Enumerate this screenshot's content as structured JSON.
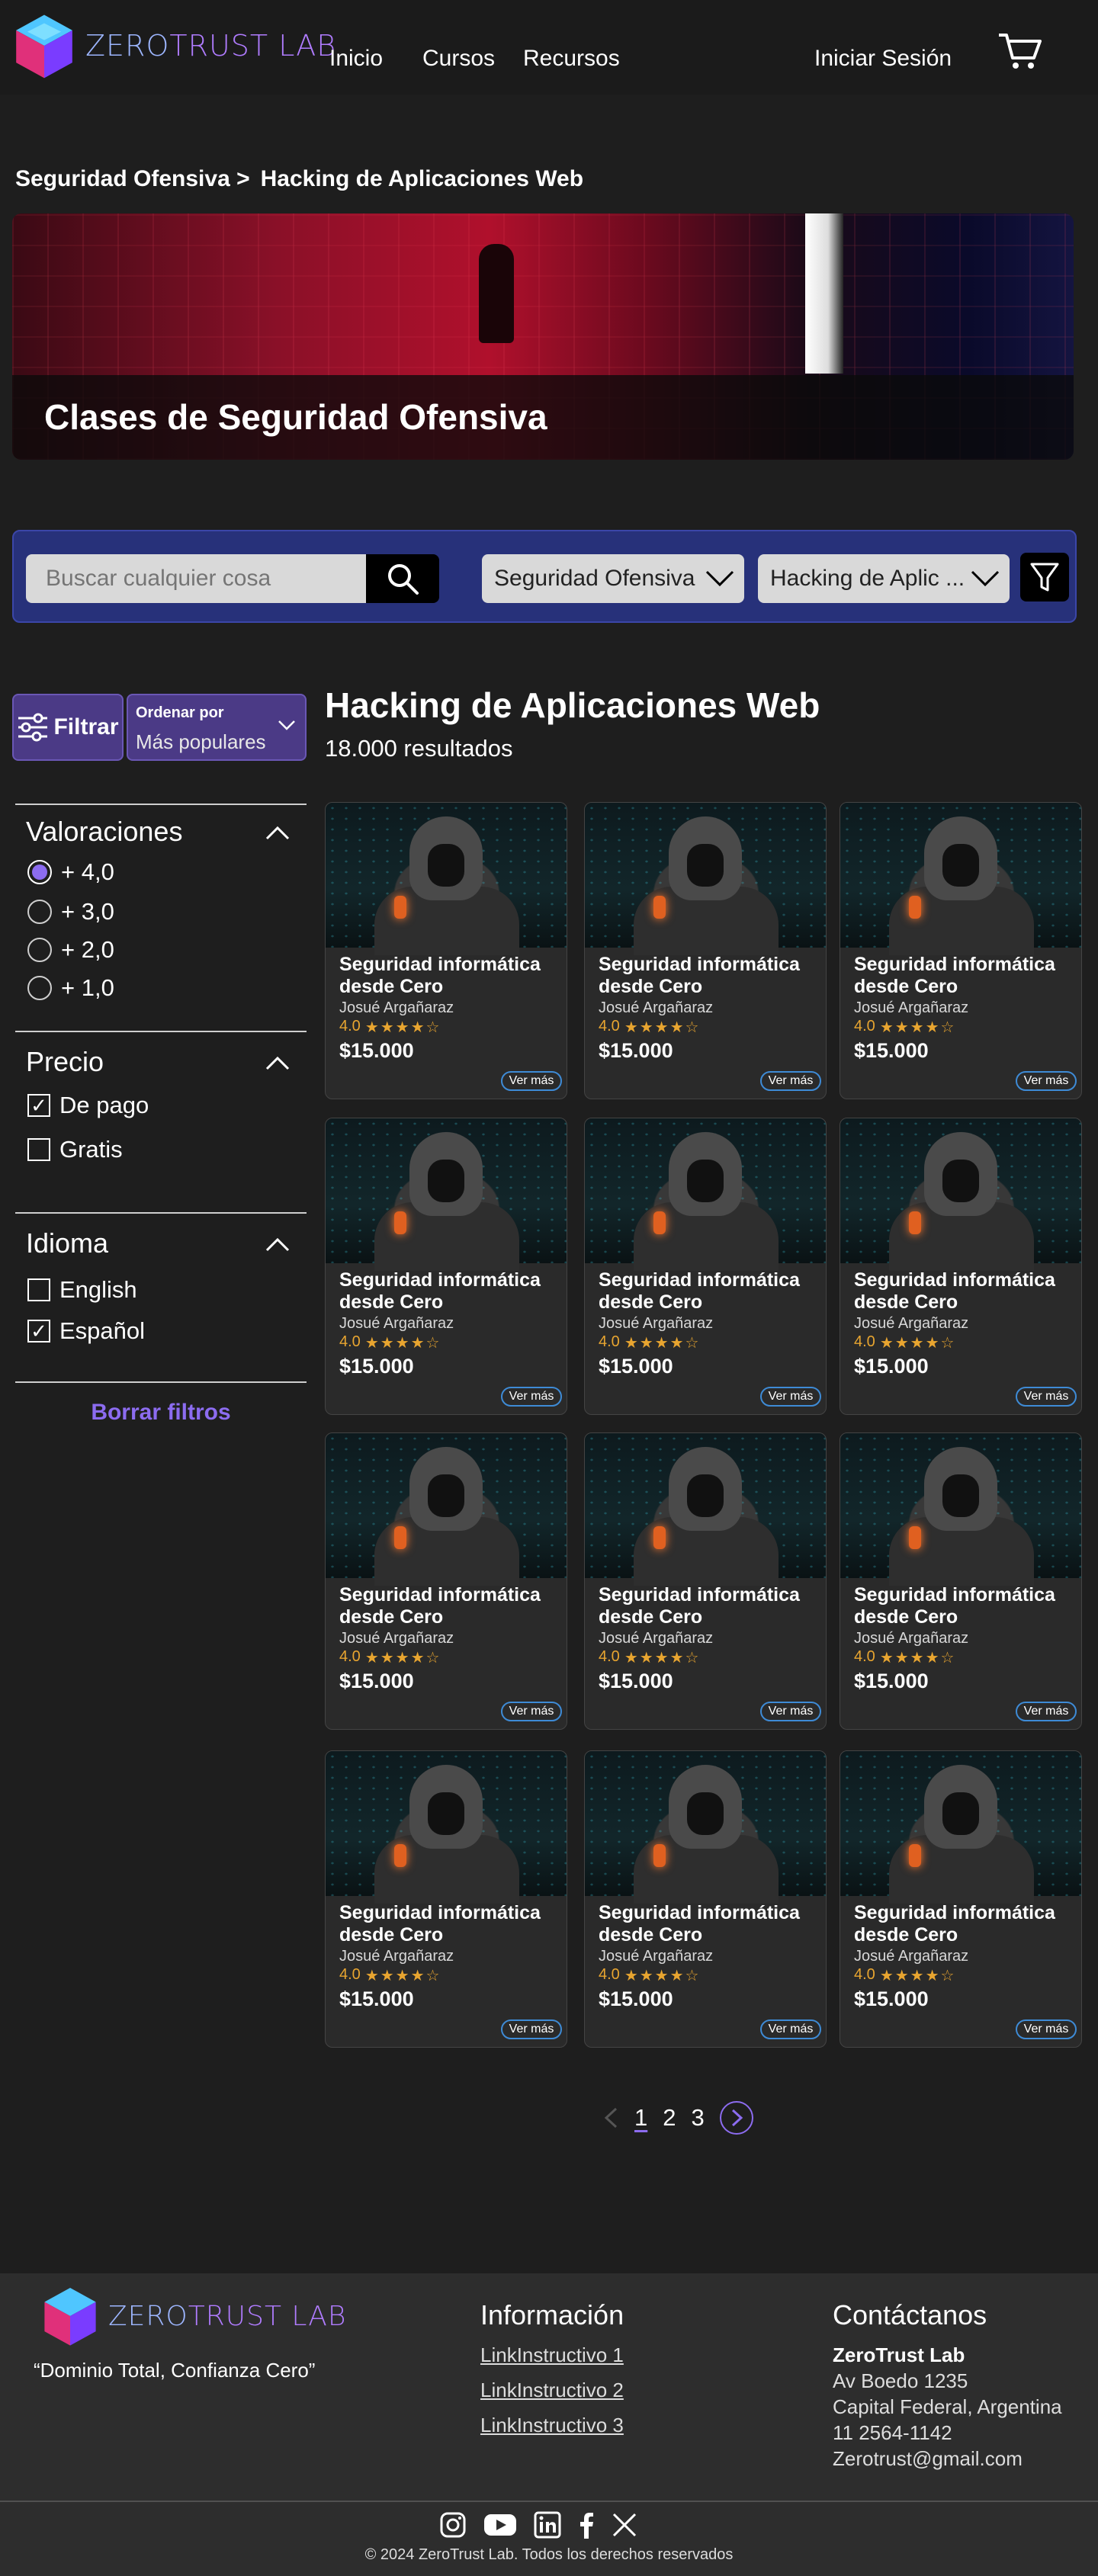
{
  "header": {
    "logo_part1": "ZERO",
    "logo_part2": "TRUST LAB",
    "nav": [
      "Inicio",
      "Cursos",
      "Recursos"
    ],
    "login": "Iniciar Sesión"
  },
  "breadcrumb": {
    "parent": "Seguridad Ofensiva >",
    "current": "Hacking de Aplicaciones Web"
  },
  "banner": {
    "title": "Clases de Seguridad Ofensiva"
  },
  "search": {
    "placeholder": "Buscar cualquier cosa",
    "category": "Seguridad Ofensiva",
    "subcategory": "Hacking de Aplic ..."
  },
  "sidebar": {
    "filter_button": "Filtrar",
    "order_label": "Ordenar por",
    "order_value": "Más populares",
    "ratings": {
      "title": "Valoraciones",
      "options": [
        "+ 4,0",
        "+ 3,0",
        "+ 2,0",
        "+ 1,0"
      ],
      "selected_index": 0
    },
    "price": {
      "title": "Precio",
      "options": [
        "De pago",
        "Gratis"
      ],
      "checked": [
        true,
        false
      ]
    },
    "language": {
      "title": "Idioma",
      "options": [
        "English",
        "Español"
      ],
      "checked": [
        false,
        true
      ]
    },
    "clear": "Borrar filtros"
  },
  "results": {
    "title": "Hacking de Aplicaciones Web",
    "count": "18.000 resultados",
    "courses": [
      {
        "title": "Seguridad informática desde Cero",
        "author": "Josué Argañaraz",
        "rating": "4.0",
        "stars": 4,
        "price": "$15.000",
        "cta": "Ver más"
      },
      {
        "title": "Seguridad informática desde Cero",
        "author": "Josué Argañaraz",
        "rating": "4.0",
        "stars": 4,
        "price": "$15.000",
        "cta": "Ver más"
      },
      {
        "title": "Seguridad informática desde Cero",
        "author": "Josué Argañaraz",
        "rating": "4.0",
        "stars": 4,
        "price": "$15.000",
        "cta": "Ver más"
      },
      {
        "title": "Seguridad informática desde Cero",
        "author": "Josué Argañaraz",
        "rating": "4.0",
        "stars": 4,
        "price": "$15.000",
        "cta": "Ver más"
      },
      {
        "title": "Seguridad informática desde Cero",
        "author": "Josué Argañaraz",
        "rating": "4.0",
        "stars": 4,
        "price": "$15.000",
        "cta": "Ver más"
      },
      {
        "title": "Seguridad informática desde Cero",
        "author": "Josué Argañaraz",
        "rating": "4.0",
        "stars": 4,
        "price": "$15.000",
        "cta": "Ver más"
      },
      {
        "title": "Seguridad informática desde Cero",
        "author": "Josué Argañaraz",
        "rating": "4.0",
        "stars": 4,
        "price": "$15.000",
        "cta": "Ver más"
      },
      {
        "title": "Seguridad informática desde Cero",
        "author": "Josué Argañaraz",
        "rating": "4.0",
        "stars": 4,
        "price": "$15.000",
        "cta": "Ver más"
      },
      {
        "title": "Seguridad informática desde Cero",
        "author": "Josué Argañaraz",
        "rating": "4.0",
        "stars": 4,
        "price": "$15.000",
        "cta": "Ver más"
      },
      {
        "title": "Seguridad informática desde Cero",
        "author": "Josué Argañaraz",
        "rating": "4.0",
        "stars": 4,
        "price": "$15.000",
        "cta": "Ver más"
      },
      {
        "title": "Seguridad informática desde Cero",
        "author": "Josué Argañaraz",
        "rating": "4.0",
        "stars": 4,
        "price": "$15.000",
        "cta": "Ver más"
      },
      {
        "title": "Seguridad informática desde Cero",
        "author": "Josué Argañaraz",
        "rating": "4.0",
        "stars": 4,
        "price": "$15.000",
        "cta": "Ver más"
      }
    ]
  },
  "pagination": {
    "pages": [
      "1",
      "2",
      "3"
    ],
    "current": "1"
  },
  "footer": {
    "slogan": "“Dominio Total, Confianza Cero”",
    "info_title": "Información",
    "links": [
      "LinkInstructivo 1",
      "LinkInstructivo 2",
      "LinkInstructivo 3"
    ],
    "contact_title": "Contáctanos",
    "contact": [
      "ZeroTrust Lab",
      "Av Boedo 1235",
      "Capital Federal, Argentina",
      "11 2564-1142",
      "Zerotrust@gmail.com"
    ],
    "copyright": "© 2024 ZeroTrust Lab. Todos los derechos reservados"
  },
  "colors": {
    "accent": "#8c6cf0",
    "search_bar": "#27317a",
    "star": "#e8a530",
    "link_button_border": "#3e8bd6"
  }
}
